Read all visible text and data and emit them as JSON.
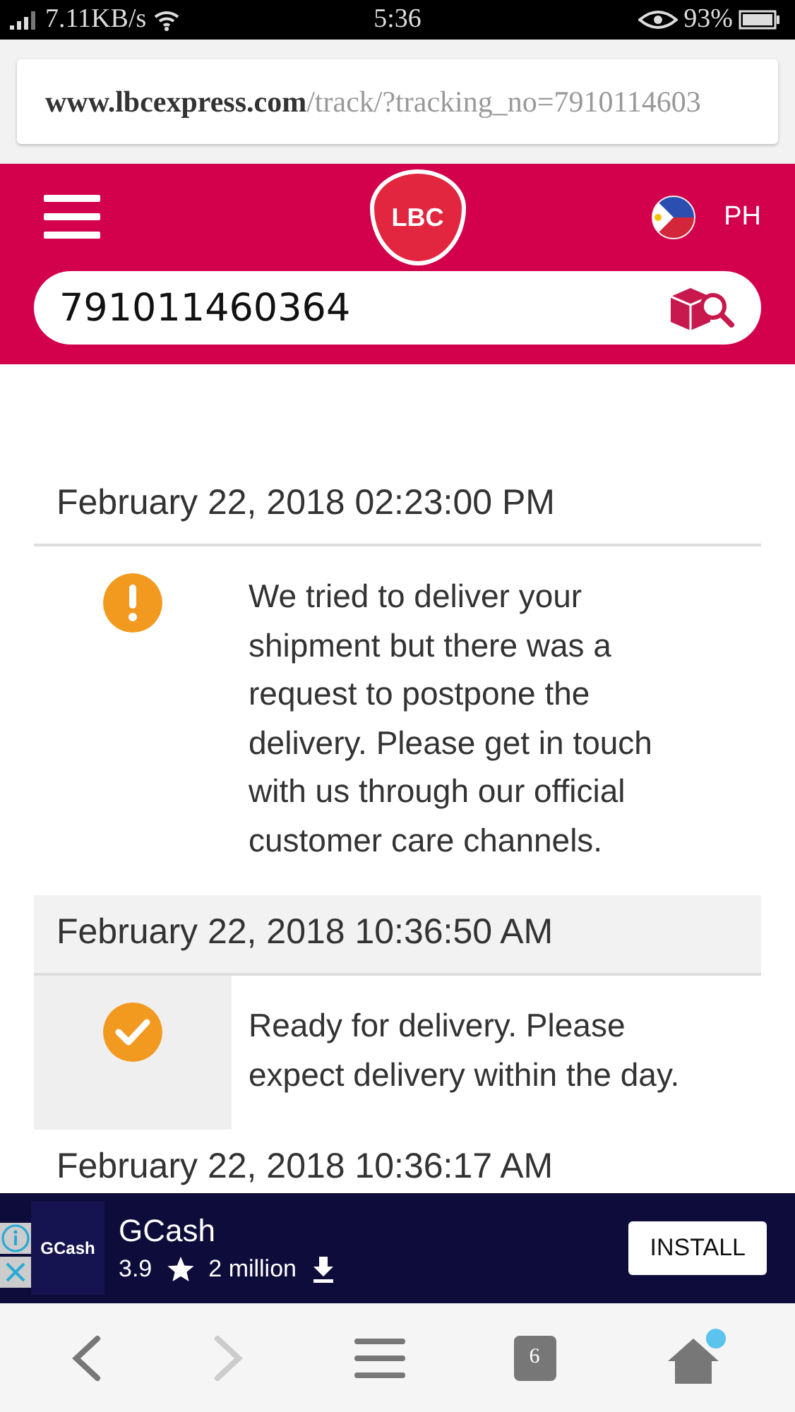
{
  "status_bar": {
    "speed": "7.11KB/s",
    "time": "5:36",
    "battery": "93%"
  },
  "address_bar": {
    "host": "www.lbcexpress.com",
    "path": "/track/?tracking_no=7910114603"
  },
  "header": {
    "logo": "LBC",
    "country": "PH"
  },
  "search": {
    "value": "791011460364"
  },
  "events": [
    {
      "date": "February 22, 2018 02:23:00 PM",
      "kind": "warning",
      "highlighted": false,
      "message": "We tried to deliver your shipment but there was a request to postpone the delivery. Please get in touch with us through our official customer care channels."
    },
    {
      "date": "February 22, 2018 10:36:50 AM",
      "kind": "check",
      "highlighted": true,
      "message": "Ready for delivery. Please expect delivery within the day."
    },
    {
      "date": "February 22, 2018 10:36:17 AM",
      "highlighted": false
    }
  ],
  "ad": {
    "logo": "GCash",
    "title": "GCash",
    "rating": "3.9",
    "installs": "2 million",
    "button": "INSTALL"
  },
  "bottom_nav": {
    "tab_count": "6"
  }
}
